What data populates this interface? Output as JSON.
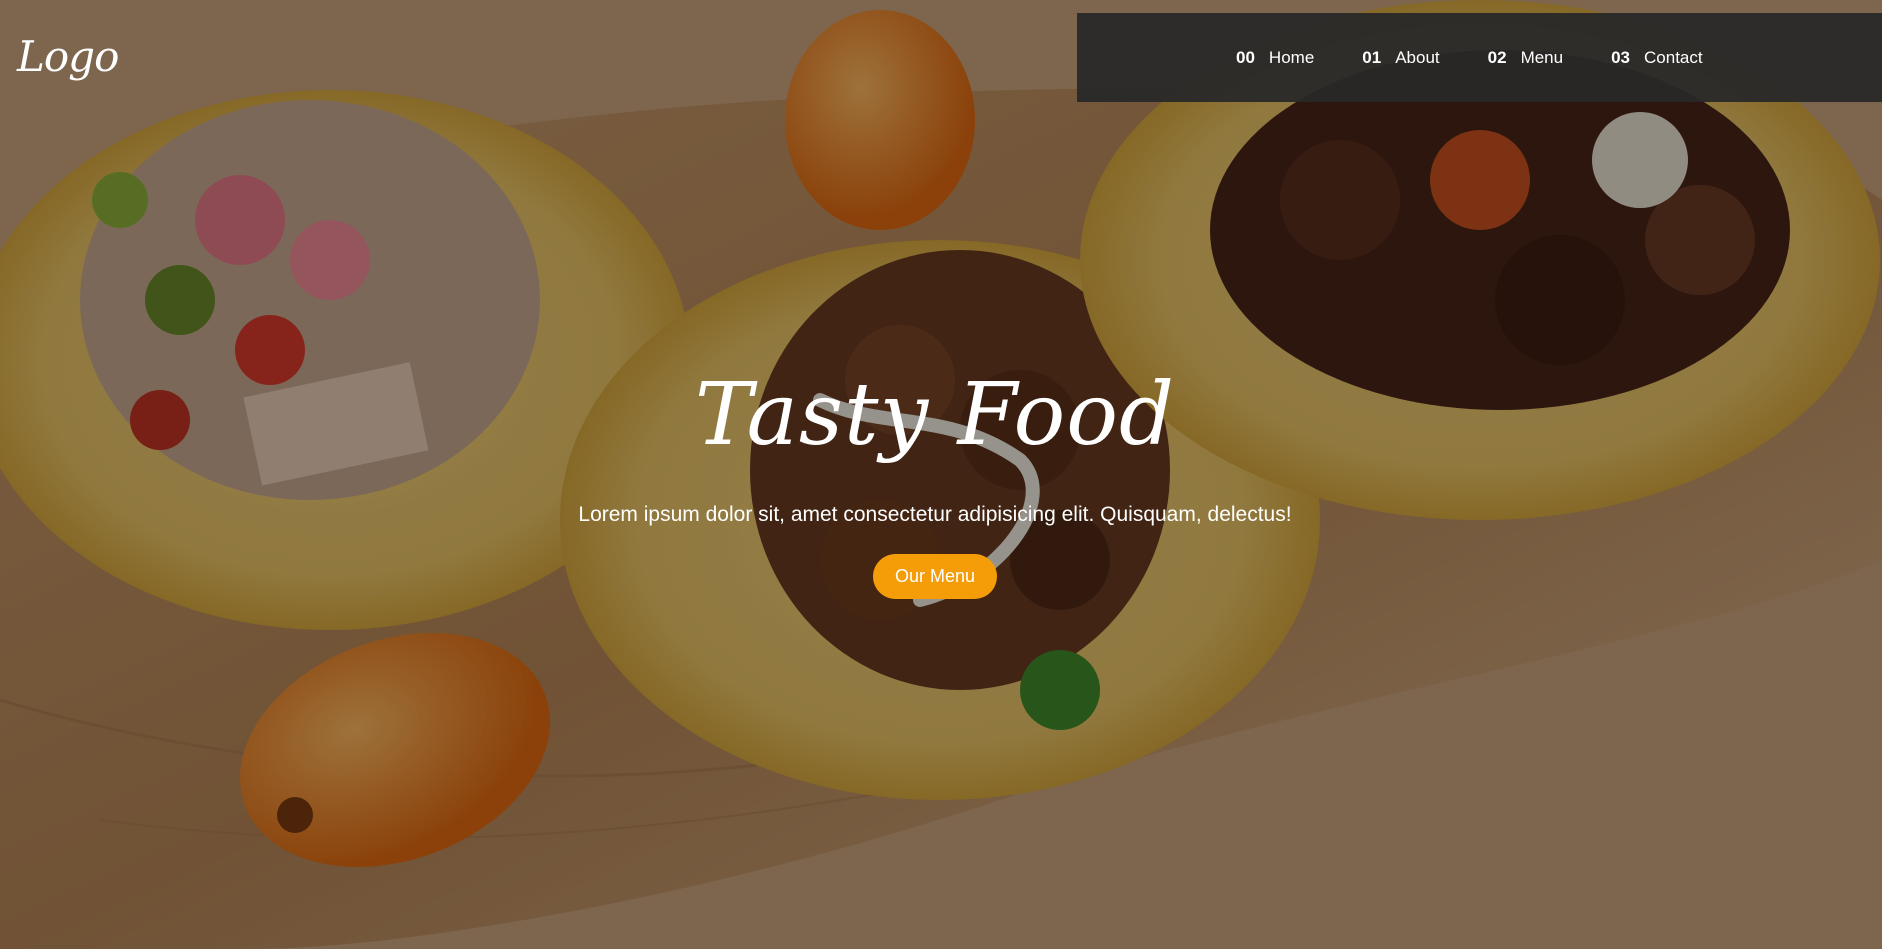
{
  "header": {
    "logo": "Logo"
  },
  "nav": {
    "items": [
      {
        "num": "00",
        "label": "Home"
      },
      {
        "num": "01",
        "label": "About"
      },
      {
        "num": "02",
        "label": "Menu"
      },
      {
        "num": "03",
        "label": "Contact"
      }
    ]
  },
  "hero": {
    "title": "Tasty Food",
    "subtitle": "Lorem ipsum dolor sit, amet consectetur adipisicing elit. Quisquam, delectus!",
    "button": "Our Menu"
  },
  "colors": {
    "accent": "#f59d09",
    "nav_bg": "#282828"
  }
}
